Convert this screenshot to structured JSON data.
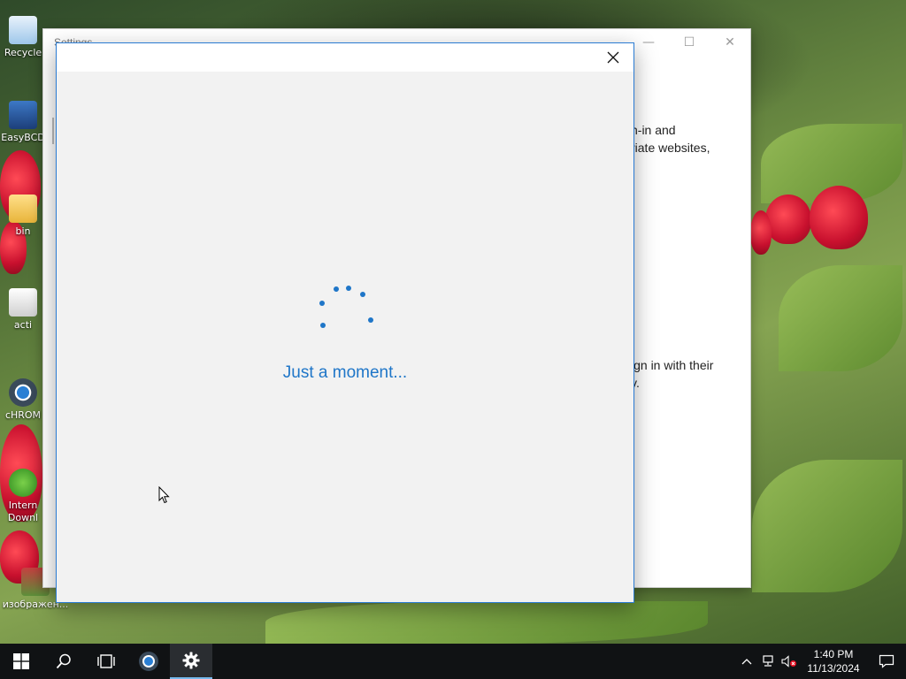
{
  "desktop": {
    "icons": [
      {
        "label": "Recycle",
        "name": "recycle-bin"
      },
      {
        "label": "EasyBCD",
        "name": "easybcd"
      },
      {
        "label": "bin",
        "name": "bin-folder"
      },
      {
        "label": "acti",
        "name": "activator"
      },
      {
        "label": "cHROM",
        "name": "chrome"
      },
      {
        "label": "Intern Downl",
        "name": "internet-download-manager"
      },
      {
        "label": "изображен...",
        "name": "image-file"
      }
    ]
  },
  "background_window": {
    "title": "Settings",
    "text_lines": [
      "n-in and",
      "riate websites,",
      "ign in with their",
      "y."
    ]
  },
  "dialog": {
    "loading_text": "Just a moment...",
    "accent_color": "#1f76c8"
  },
  "taskbar": {
    "clock_time": "1:40 PM",
    "clock_date": "11/13/2024",
    "active_app": "settings"
  }
}
